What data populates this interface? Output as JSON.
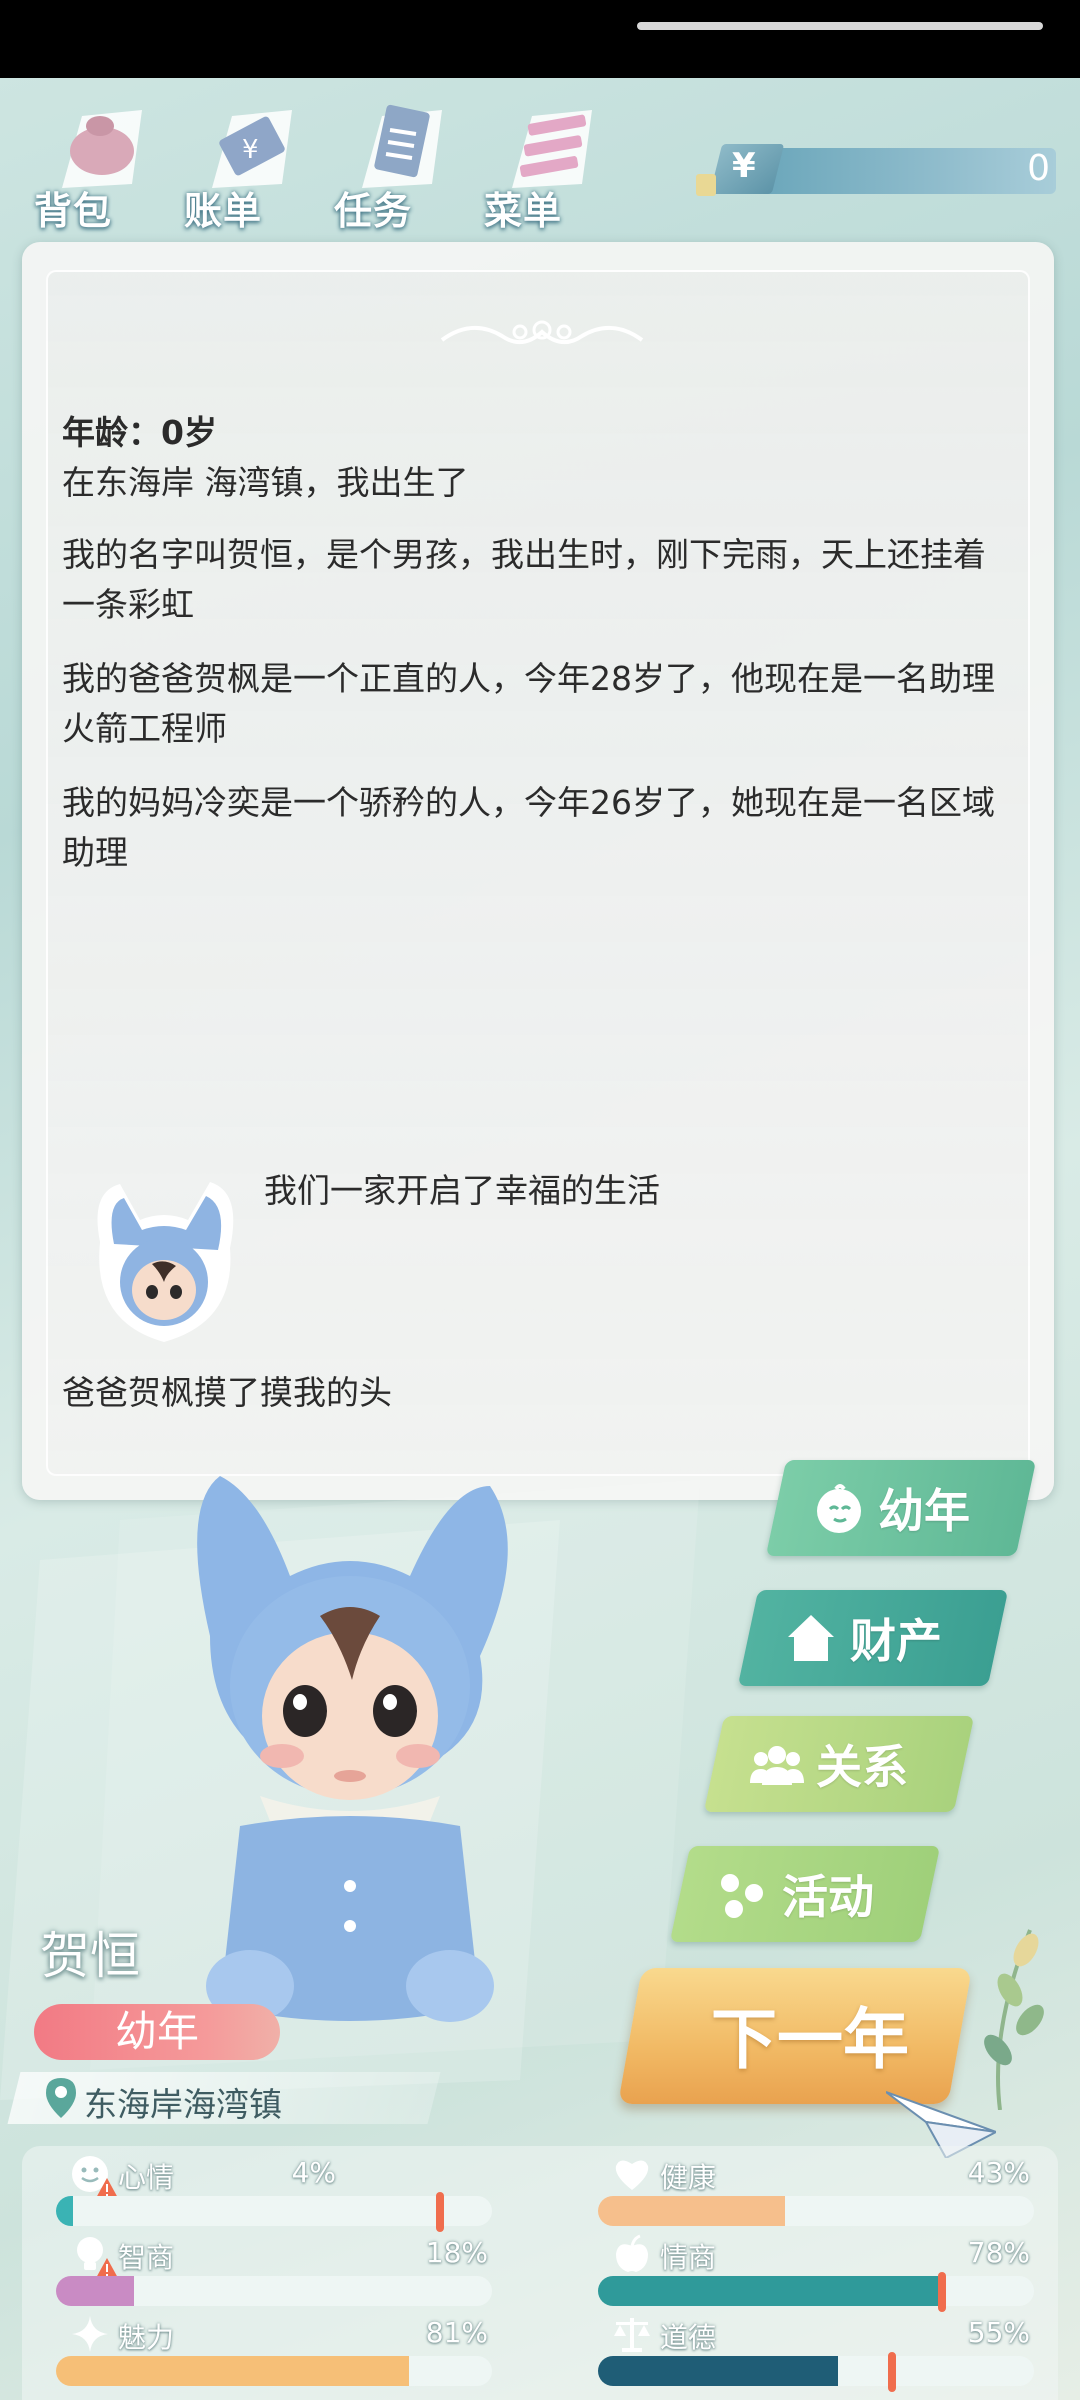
{
  "toolbar": {
    "items": [
      {
        "label": "背包",
        "icon": "bag-icon"
      },
      {
        "label": "账单",
        "icon": "bill-icon"
      },
      {
        "label": "任务",
        "icon": "task-icon"
      },
      {
        "label": "菜单",
        "icon": "menu-icon"
      }
    ],
    "currency_symbol": "¥",
    "money": "0"
  },
  "story": {
    "age_line": "年龄：0岁",
    "paragraphs": [
      "在东海岸 海湾镇，我出生了",
      "我的名字叫贺恒，是个男孩，我出生时，刚下完雨，天上还挂着一条彩虹",
      "我的爸爸贺枫是一个正直的人，今年28岁了，他现在是一名助理火箭工程师",
      "我的妈妈冷奕是一个骄矜的人，今年26岁了，她现在是一名区域助理"
    ],
    "family_line": "我们一家开启了幸福的生活",
    "event_line": "爸爸贺枫摸了摸我的头"
  },
  "menu": {
    "life_stage": "幼年",
    "property": "财产",
    "relations": "关系",
    "activities": "活动",
    "next_year": "下一年"
  },
  "character": {
    "name": "贺恒",
    "stage": "幼年",
    "location": "东海岸海湾镇"
  },
  "stats": {
    "mood": {
      "label": "心情",
      "value": "4%",
      "level": 0.04,
      "color": "#3ab3b4"
    },
    "health": {
      "label": "健康",
      "value": "43%",
      "level": 0.43,
      "color": "#f6bf8c"
    },
    "iq": {
      "label": "智商",
      "value": "18%",
      "level": 0.18,
      "color": "#c98bc4"
    },
    "eq": {
      "label": "情商",
      "value": "78%",
      "level": 0.78,
      "color": "#2f9a9a"
    },
    "charm": {
      "label": "魅力",
      "value": "81%",
      "level": 0.81,
      "color": "#f6bf77"
    },
    "morality": {
      "label": "道德",
      "value": "55%",
      "level": 0.55,
      "color": "#1f5d76"
    }
  }
}
